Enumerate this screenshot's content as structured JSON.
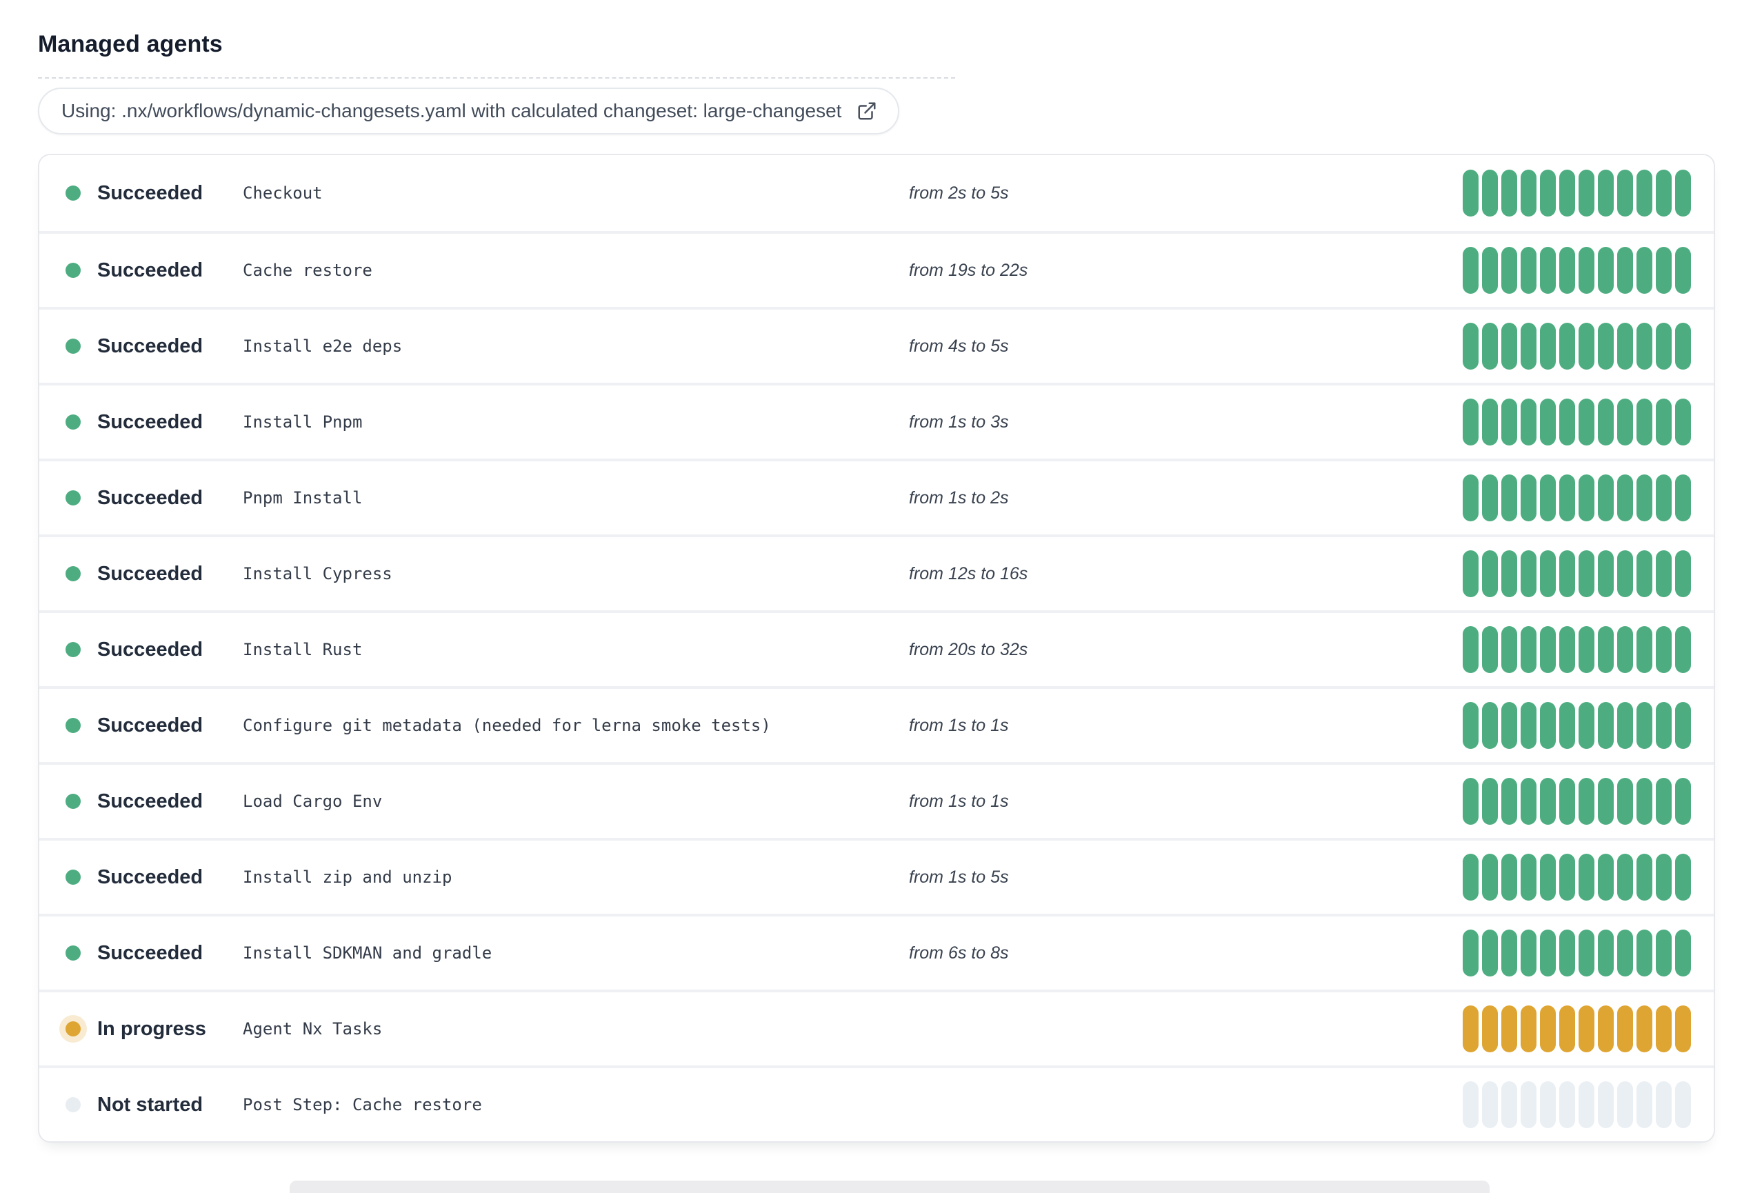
{
  "page": {
    "title": "Managed agents"
  },
  "badge": {
    "label": "Using: .nx/workflows/dynamic-changesets.yaml with calculated changeset: large-changeset",
    "icon": "external-link-icon"
  },
  "colors": {
    "succeeded": "#4dad81",
    "in_progress": "#dfa532",
    "not_started": "#eaeff4",
    "in_progress_halo": "rgba(223,165,50,0.22)"
  },
  "bar": {
    "segments": 12
  },
  "rows": [
    {
      "status": "Succeeded",
      "state": "succeeded",
      "step": "Checkout",
      "duration": "from 2s to 5s"
    },
    {
      "status": "Succeeded",
      "state": "succeeded",
      "step": "Cache restore",
      "duration": "from 19s to 22s"
    },
    {
      "status": "Succeeded",
      "state": "succeeded",
      "step": "Install e2e deps",
      "duration": "from 4s to 5s"
    },
    {
      "status": "Succeeded",
      "state": "succeeded",
      "step": "Install Pnpm",
      "duration": "from 1s to 3s"
    },
    {
      "status": "Succeeded",
      "state": "succeeded",
      "step": "Pnpm Install",
      "duration": "from 1s to 2s"
    },
    {
      "status": "Succeeded",
      "state": "succeeded",
      "step": "Install Cypress",
      "duration": "from 12s to 16s"
    },
    {
      "status": "Succeeded",
      "state": "succeeded",
      "step": "Install Rust",
      "duration": "from 20s to 32s"
    },
    {
      "status": "Succeeded",
      "state": "succeeded",
      "step": "Configure git metadata (needed for lerna smoke tests)",
      "duration": "from 1s to 1s"
    },
    {
      "status": "Succeeded",
      "state": "succeeded",
      "step": "Load Cargo Env",
      "duration": "from 1s to 1s"
    },
    {
      "status": "Succeeded",
      "state": "succeeded",
      "step": "Install zip and unzip",
      "duration": "from 1s to 5s"
    },
    {
      "status": "Succeeded",
      "state": "succeeded",
      "step": "Install SDKMAN and gradle",
      "duration": "from 6s to 8s"
    },
    {
      "status": "In progress",
      "state": "in-progress",
      "step": "Agent Nx Tasks",
      "duration": ""
    },
    {
      "status": "Not started",
      "state": "not-started",
      "step": "Post Step: Cache restore",
      "duration": ""
    }
  ]
}
